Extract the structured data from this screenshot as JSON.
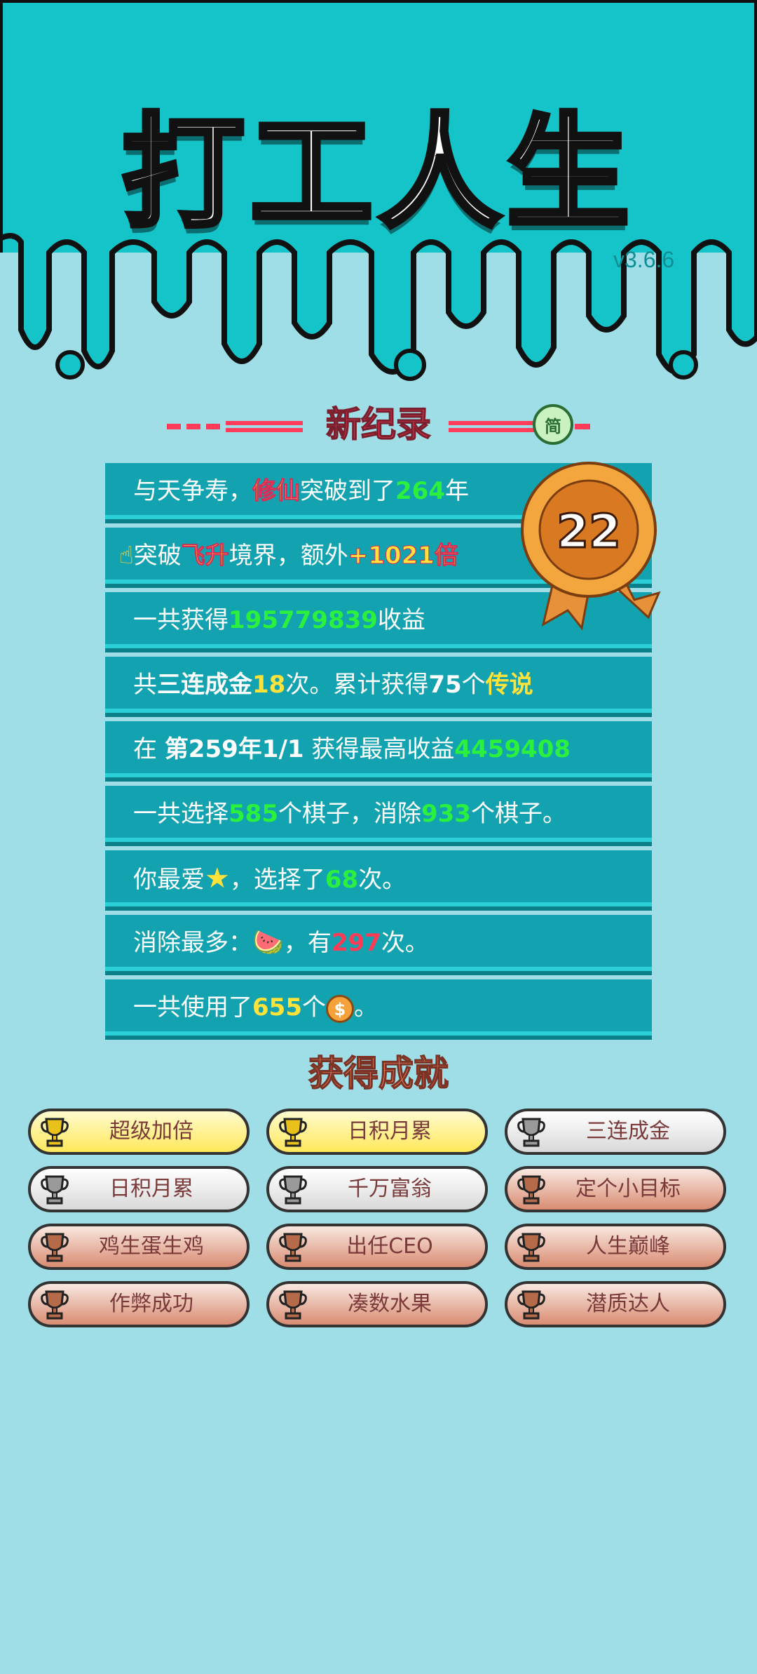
{
  "app": {
    "title": "打工人生",
    "version": "v3.6.6"
  },
  "banner": {
    "title": "新纪录",
    "badge_char": "简"
  },
  "medal": {
    "value": "22"
  },
  "stats": [
    {
      "parts": [
        {
          "t": "与天争寿，"
        },
        {
          "t": "修仙",
          "c": "pink"
        },
        {
          "t": "突破到了"
        },
        {
          "t": "264",
          "c": "green"
        },
        {
          "t": "年"
        }
      ]
    },
    {
      "parts": [
        {
          "t": "突破"
        },
        {
          "t": "飞升",
          "c": "pink"
        },
        {
          "t": "境界，额外"
        },
        {
          "t": "+1021倍",
          "c": "pink"
        }
      ],
      "icon": "pointing-hand-icon"
    },
    {
      "parts": [
        {
          "t": "一共获得"
        },
        {
          "t": "195779839",
          "c": "green"
        },
        {
          "t": "收益"
        }
      ]
    },
    {
      "parts": [
        {
          "t": "共"
        },
        {
          "t": "三连成金",
          "c": "white"
        },
        {
          "t": "18",
          "c": "yellow"
        },
        {
          "t": "次。累计获得"
        },
        {
          "t": "75",
          "c": "white"
        },
        {
          "t": "个"
        },
        {
          "t": "传说",
          "c": "yellow"
        }
      ]
    },
    {
      "parts": [
        {
          "t": "在 "
        },
        {
          "t": "第259年1/1",
          "c": "white"
        },
        {
          "t": " 获得最高收益"
        },
        {
          "t": "4459408",
          "c": "green"
        }
      ]
    },
    {
      "parts": [
        {
          "t": "一共选择"
        },
        {
          "t": "585",
          "c": "green"
        },
        {
          "t": "个棋子，消除"
        },
        {
          "t": "933",
          "c": "green"
        },
        {
          "t": "个棋子。"
        }
      ]
    },
    {
      "parts": [
        {
          "t": "你最爱"
        },
        {
          "t": "★",
          "c": "star"
        },
        {
          "t": "，选择了"
        },
        {
          "t": "68",
          "c": "green"
        },
        {
          "t": "次。"
        }
      ]
    },
    {
      "parts": [
        {
          "t": "消除最多："
        },
        {
          "t": "🍉",
          "c": "melon"
        },
        {
          "t": "，有"
        },
        {
          "t": "297",
          "c": "red"
        },
        {
          "t": "次。"
        }
      ]
    },
    {
      "parts": [
        {
          "t": "一共使用了"
        },
        {
          "t": "655",
          "c": "yellow"
        },
        {
          "t": "个"
        },
        {
          "t": "$",
          "c": "coin"
        },
        {
          "t": "。"
        }
      ]
    }
  ],
  "achievements_title": "获得成就",
  "achievements": [
    {
      "label": "超级加倍",
      "tier": "gold"
    },
    {
      "label": "日积月累",
      "tier": "gold"
    },
    {
      "label": "三连成金",
      "tier": "silver"
    },
    {
      "label": "日积月累",
      "tier": "silver"
    },
    {
      "label": "千万富翁",
      "tier": "silver"
    },
    {
      "label": "定个小目标",
      "tier": "bronze"
    },
    {
      "label": "鸡生蛋生鸡",
      "tier": "bronze"
    },
    {
      "label": "出任CEO",
      "tier": "bronze"
    },
    {
      "label": "人生巅峰",
      "tier": "bronze"
    },
    {
      "label": "作弊成功",
      "tier": "bronze"
    },
    {
      "label": "凑数水果",
      "tier": "bronze"
    },
    {
      "label": "潜质达人",
      "tier": "bronze"
    }
  ],
  "colors": {
    "band": "#14c4c8",
    "bg": "#9fdee6",
    "row": "#13a3b0",
    "gold": "#ffe85a",
    "silver": "#d9d9d9",
    "bronze": "#d98c72"
  }
}
